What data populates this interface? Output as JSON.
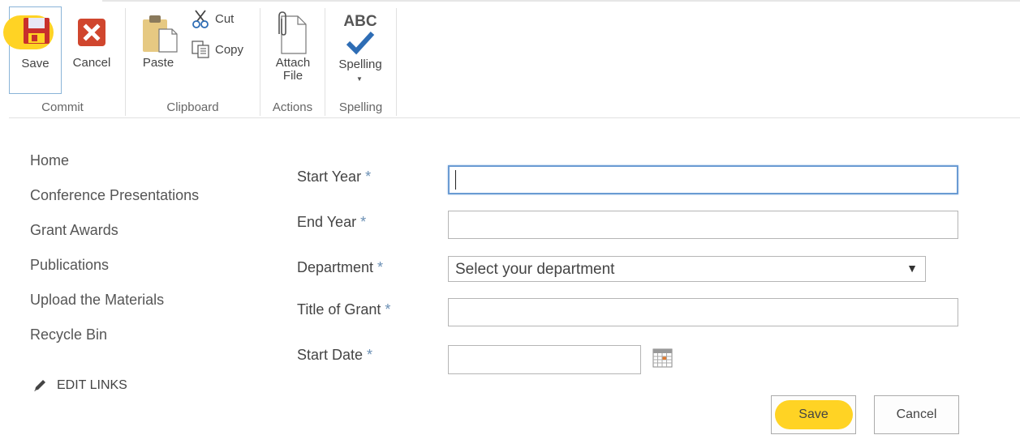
{
  "ribbon": {
    "groups": [
      {
        "label": "Commit"
      },
      {
        "label": "Clipboard"
      },
      {
        "label": "Actions"
      },
      {
        "label": "Spelling"
      }
    ],
    "save_label": "Save",
    "cancel_label": "Cancel",
    "paste_label": "Paste",
    "cut_label": "Cut",
    "copy_label": "Copy",
    "attach_label_line1": "Attach",
    "attach_label_line2": "File",
    "spelling_label": "Spelling",
    "spelling_icon_text": "ABC"
  },
  "nav": {
    "items": [
      {
        "label": "Home"
      },
      {
        "label": "Conference Presentations"
      },
      {
        "label": "Grant Awards"
      },
      {
        "label": "Publications"
      },
      {
        "label": "Upload the Materials"
      },
      {
        "label": "Recycle Bin"
      }
    ],
    "edit_links": "EDIT LINKS"
  },
  "form": {
    "required_marker": "*",
    "fields": [
      {
        "label": "Start Year",
        "value": ""
      },
      {
        "label": "End Year",
        "value": ""
      },
      {
        "label": "Department",
        "value": "Select your department"
      },
      {
        "label": "Title of Grant",
        "value": ""
      },
      {
        "label": "Start Date",
        "value": ""
      }
    ],
    "save_button": "Save",
    "cancel_button": "Cancel"
  },
  "colors": {
    "highlight": "#ffd324",
    "required_marker": "#6a8fb4",
    "focus_border": "#6a9bd3",
    "cancel_icon": "#d0462e",
    "save_icon": "#c8302c"
  },
  "icons": [
    "save-icon",
    "cancel-icon",
    "paste-icon",
    "cut-icon",
    "copy-icon",
    "attach-file-icon",
    "spelling-icon",
    "pencil-icon",
    "calendar-icon",
    "dropdown-arrow-icon"
  ]
}
